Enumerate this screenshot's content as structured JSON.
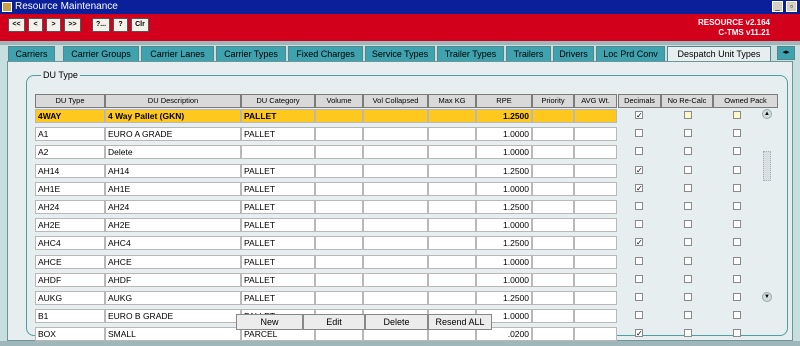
{
  "window": {
    "title": "Resource Maintenance"
  },
  "toolbar": {
    "buttons": [
      "<<",
      "<",
      ">",
      ">>",
      "?...",
      "?",
      "Clr"
    ]
  },
  "version": {
    "line1": "RESOURCE v2.164",
    "line2": "C-TMS v11.21"
  },
  "tabs": [
    "Carriers",
    "Carrier Groups",
    "Carrier Lanes",
    "Carrier Types",
    "Fixed Charges",
    "Service Types",
    "Trailer Types",
    "Trailers",
    "Drivers",
    "Loc Prd Conv",
    "Despatch Unit Types"
  ],
  "active_tab": "Despatch Unit Types",
  "section": {
    "title": "DU Type"
  },
  "columns": [
    "DU Type",
    "DU Description",
    "DU Category",
    "Volume",
    "Vol Collapsed",
    "Max KG",
    "RPE",
    "Priority",
    "AVG Wt.",
    "Decimals",
    "No Re-Calc",
    "Owned Pack"
  ],
  "rows": [
    {
      "type": "4WAY",
      "desc": "4 Way Pallet (GKN)",
      "cat": "PALLET",
      "rpe": "1.2500",
      "decimals": true,
      "no_recalc": false,
      "owned": false
    },
    {
      "type": "A1",
      "desc": "EURO A GRADE",
      "cat": "PALLET",
      "rpe": "1.0000",
      "decimals": false,
      "no_recalc": false,
      "owned": false
    },
    {
      "type": "A2",
      "desc": "Delete",
      "cat": "",
      "rpe": "1.0000",
      "decimals": false,
      "no_recalc": false,
      "owned": false
    },
    {
      "type": "AH14",
      "desc": "AH14",
      "cat": "PALLET",
      "rpe": "1.2500",
      "decimals": true,
      "no_recalc": false,
      "owned": false
    },
    {
      "type": "AH1E",
      "desc": "AH1E",
      "cat": "PALLET",
      "rpe": "1.0000",
      "decimals": true,
      "no_recalc": false,
      "owned": false
    },
    {
      "type": "AH24",
      "desc": "AH24",
      "cat": "PALLET",
      "rpe": "1.2500",
      "decimals": false,
      "no_recalc": false,
      "owned": false
    },
    {
      "type": "AH2E",
      "desc": "AH2E",
      "cat": "PALLET",
      "rpe": "1.0000",
      "decimals": false,
      "no_recalc": false,
      "owned": false
    },
    {
      "type": "AHC4",
      "desc": "AHC4",
      "cat": "PALLET",
      "rpe": "1.2500",
      "decimals": true,
      "no_recalc": false,
      "owned": false
    },
    {
      "type": "AHCE",
      "desc": "AHCE",
      "cat": "PALLET",
      "rpe": "1.0000",
      "decimals": false,
      "no_recalc": false,
      "owned": false
    },
    {
      "type": "AHDF",
      "desc": "AHDF",
      "cat": "PALLET",
      "rpe": "1.0000",
      "decimals": false,
      "no_recalc": false,
      "owned": false
    },
    {
      "type": "AUKG",
      "desc": "AUKG",
      "cat": "PALLET",
      "rpe": "1.2500",
      "decimals": false,
      "no_recalc": false,
      "owned": false
    },
    {
      "type": "B1",
      "desc": "EURO B GRADE",
      "cat": "PALLET",
      "rpe": "1.0000",
      "decimals": false,
      "no_recalc": false,
      "owned": false
    },
    {
      "type": "BOX",
      "desc": "SMALL",
      "cat": "PARCEL",
      "rpe": ".0200",
      "decimals": true,
      "no_recalc": false,
      "owned": false
    }
  ],
  "buttons": {
    "new": "New",
    "edit": "Edit",
    "delete": "Delete",
    "resend": "Resend ALL"
  },
  "colors": {
    "title_bar": "#0b1f9b",
    "header_bar": "#d3001b",
    "tab": "#3ea3ae",
    "selected_row": "#ffc81e",
    "panel": "#e6eeef"
  }
}
